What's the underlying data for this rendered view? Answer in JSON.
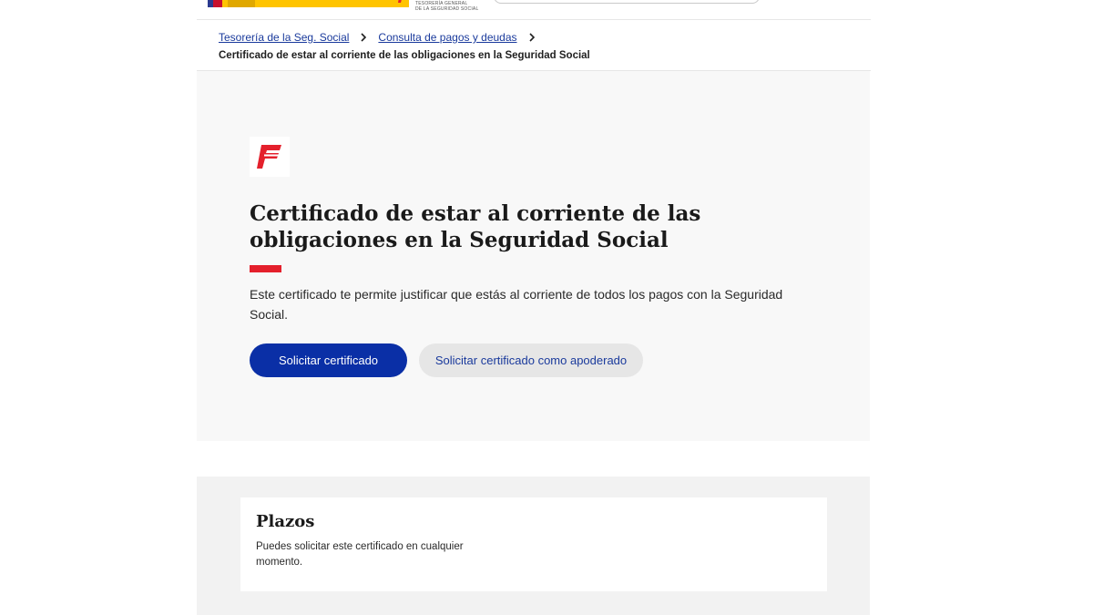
{
  "header": {
    "institution_text_line1": "TESORERÍA GENERAL",
    "institution_text_line2": "DE LA SEGURIDAD SOCIAL"
  },
  "breadcrumb": {
    "items": [
      {
        "label": "Tesorería de la Seg. Social"
      },
      {
        "label": "Consulta de pagos y deudas"
      }
    ],
    "current": "Certificado de estar al corriente de las obligaciones en la Seguridad Social"
  },
  "hero": {
    "logo_icon": "tgss-logo-icon",
    "title": "Certificado de estar al corriente de las obligaciones en la Seguridad Social",
    "description": "Este certificado te permite justificar que estás al corriente de todos los pagos con la Seguridad Social.",
    "primary_button": "Solicitar certificado",
    "secondary_button": "Solicitar certificado como apoderado"
  },
  "plazos": {
    "title": "Plazos",
    "text": "Puedes solicitar este certificado en cualquier momento."
  },
  "colors": {
    "primary": "#0a2fa6",
    "accent_red": "#e4202c",
    "link": "#1a3a9c"
  }
}
